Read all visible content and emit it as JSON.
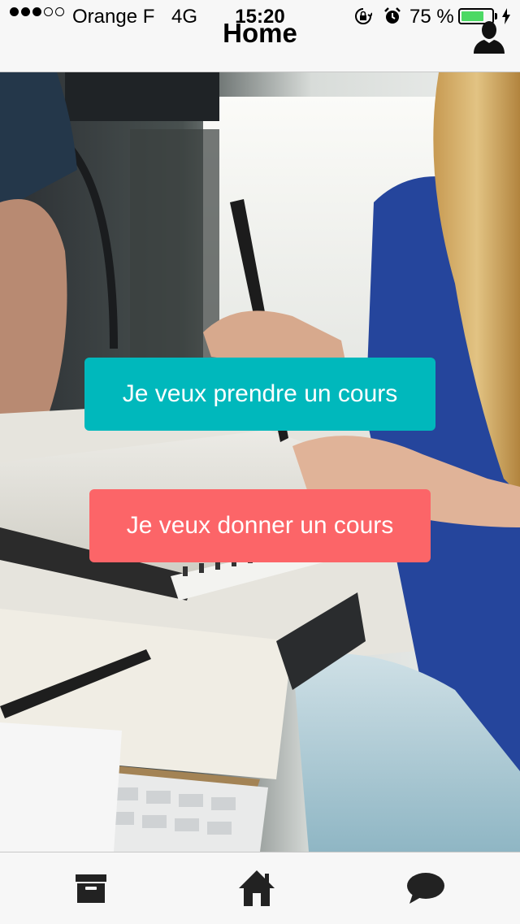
{
  "status_bar": {
    "carrier": "Orange F",
    "network": "4G",
    "time": "15:20",
    "battery_percent": "75 %",
    "battery_level": 0.75,
    "signal_bars_filled": 3,
    "signal_bars_total": 5
  },
  "nav": {
    "title": "Home",
    "profile_icon": "user-silhouette-icon"
  },
  "hero": {
    "image": "students-studying-photo"
  },
  "actions": {
    "take_course_label": "Je veux prendre un cours",
    "give_course_label": "Je veux donner un cours"
  },
  "tabbar": {
    "tabs": [
      {
        "icon": "archive-box-icon"
      },
      {
        "icon": "home-icon"
      },
      {
        "icon": "chat-bubble-icon"
      }
    ]
  },
  "colors": {
    "take_button": "#00b8bc",
    "give_button": "#fc6568",
    "bar_background": "#f7f7f7",
    "icon_dark": "#222222"
  }
}
